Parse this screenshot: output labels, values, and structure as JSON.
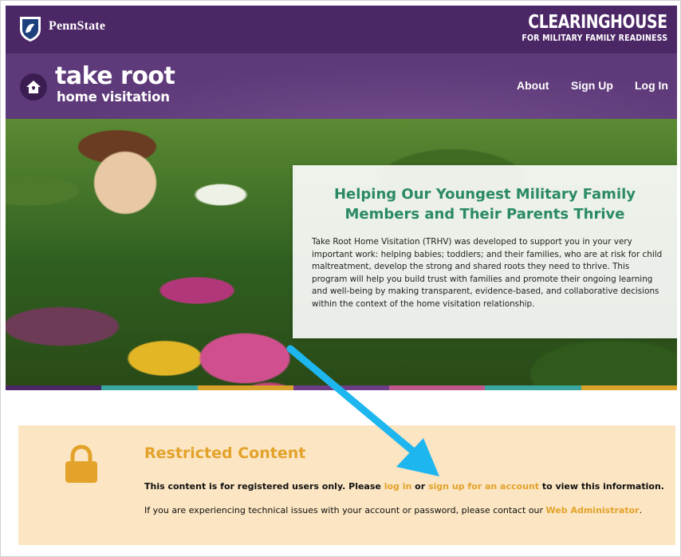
{
  "header": {
    "pennstate_label": "PennState",
    "clearinghouse_title": "CLEARINGHOUSE",
    "clearinghouse_subtitle": "FOR MILITARY FAMILY READINESS"
  },
  "nav": {
    "logo_line1": "take root",
    "logo_line2": "home visitation",
    "links": [
      {
        "label": "About"
      },
      {
        "label": "Sign Up"
      },
      {
        "label": "Log In"
      }
    ]
  },
  "hero": {
    "title": "Helping Our Youngest Military Family Members and Their Parents Thrive",
    "body": "Take Root Home Visitation (TRHV) was developed to support you in your very important work: helping babies; toddlers; and their families, who are at risk for child maltreatment, develop the strong and shared roots they need to thrive. This program will help you build trust with families and promote their ongoing learning and well-being by making transparent, evidence-based, and collaborative decisions within the context of the home visitation relationship."
  },
  "stripe_colors": [
    "#4c2766",
    "#3aa6a0",
    "#d9a22a",
    "#6c3c84",
    "#c0578c",
    "#3aa6a0",
    "#d9a22a"
  ],
  "restricted": {
    "title": "Restricted Content",
    "line1_before": "This content is for registered users only. Please ",
    "line1_login": "log in",
    "line1_or": " or ",
    "line1_signup": "sign up for an account",
    "line1_after": " to view this information.",
    "line2_before": "If you are experiencing technical issues with your account or password, please contact our ",
    "line2_link": "Web Administrator",
    "line2_after": "."
  },
  "colors": {
    "brand_purple": "#4c2766",
    "accent_green": "#2a8a63",
    "accent_gold": "#e3a22a",
    "annotation_arrow": "#1eb6ee"
  }
}
